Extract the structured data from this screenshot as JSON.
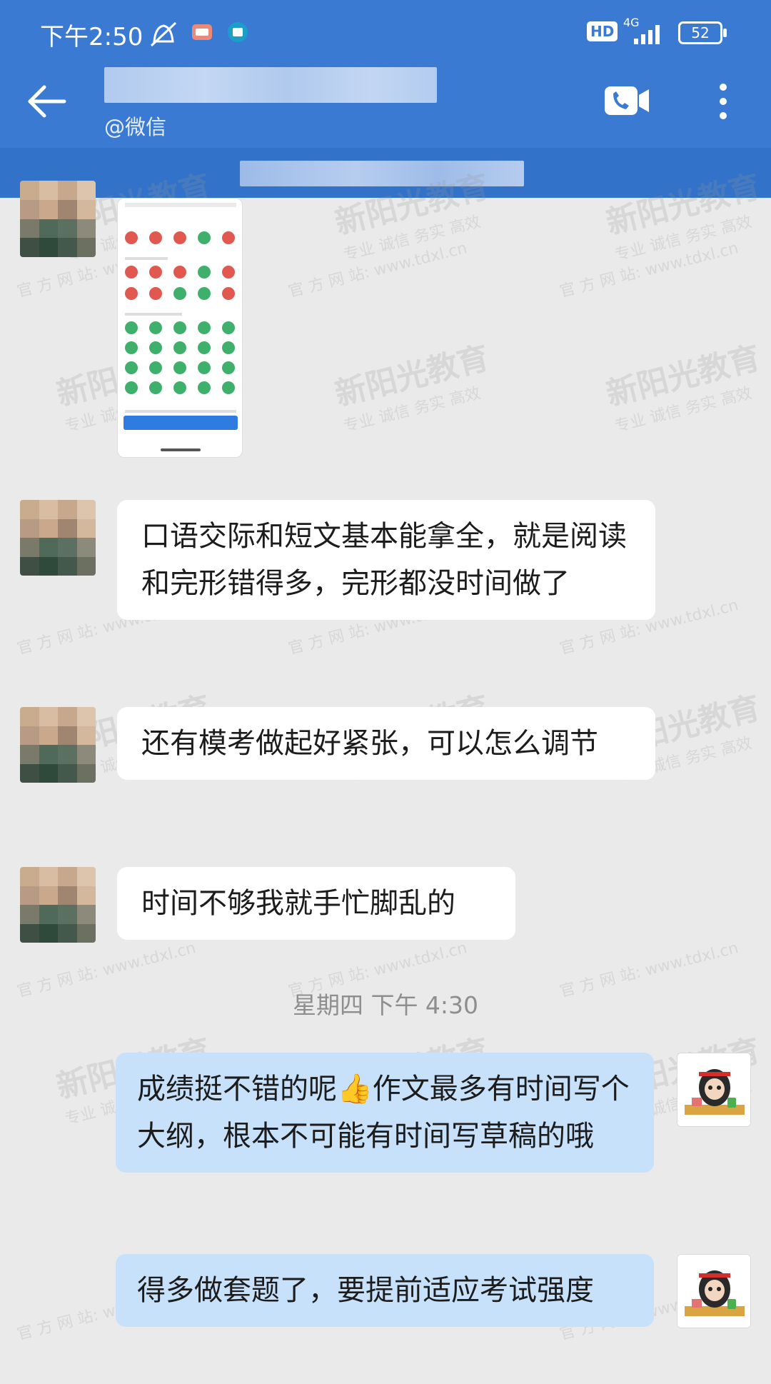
{
  "status_bar": {
    "time": "下午2:50",
    "hd": "HD",
    "network": "4G",
    "battery": "52"
  },
  "header": {
    "subtitle": "@微信"
  },
  "messages": [
    {
      "from": "other",
      "type": "image"
    },
    {
      "from": "other",
      "text": "口语交际和短文基本能拿全，就是阅读和完形错得多，完形都没时间做了"
    },
    {
      "from": "other",
      "text": "还有模考做起好紧张，可以怎么调节"
    },
    {
      "from": "other",
      "text": "时间不够我就手忙脚乱的"
    },
    {
      "from": "me",
      "text": "成绩挺不错的呢👍作文最多有时间写个大纲，根本不可能有时间写草稿的哦"
    },
    {
      "from": "me",
      "text": "得多做套题了，要提前适应考试强度"
    }
  ],
  "timestamp": "星期四 下午 4:30",
  "watermark": {
    "brand": "新阳光教育",
    "slogan": "专业  诚信  务实  高效",
    "site": "官 方 网 站: www.tdxl.cn"
  },
  "colors": {
    "header": "#3b7ad2",
    "background": "#eaeaea",
    "my_bubble": "#c7e1fb"
  }
}
